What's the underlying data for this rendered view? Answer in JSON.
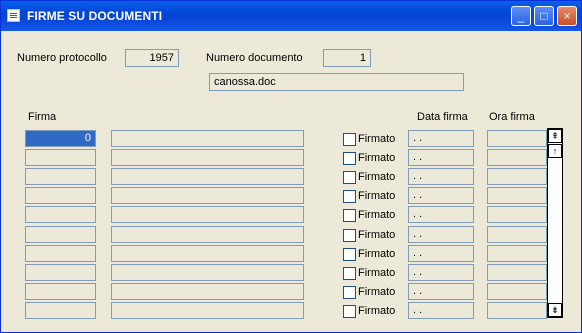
{
  "window": {
    "title": "FIRME SU DOCUMENTI",
    "controls": {
      "minimize": "_",
      "maximize": "□",
      "close": "×"
    }
  },
  "header": {
    "protocol_label": "Numero protocollo",
    "protocol_value": "1957",
    "document_label": "Numero documento",
    "document_value": "1",
    "filename": "canossa.doc"
  },
  "columns": {
    "firma": "Firma",
    "data_firma": "Data firma",
    "ora_firma": "Ora firma"
  },
  "rows": [
    {
      "firma_code": "0",
      "firma_name": "",
      "firmato_label": "Firmato",
      "date": " . .",
      "time": ""
    },
    {
      "firma_code": "",
      "firma_name": "",
      "firmato_label": "Firmato",
      "date": " . .",
      "time": ""
    },
    {
      "firma_code": "",
      "firma_name": "",
      "firmato_label": "Firmato",
      "date": " . .",
      "time": ""
    },
    {
      "firma_code": "",
      "firma_name": "",
      "firmato_label": "Firmato",
      "date": " . .",
      "time": ""
    },
    {
      "firma_code": "",
      "firma_name": "",
      "firmato_label": "Firmato",
      "date": " . .",
      "time": ""
    },
    {
      "firma_code": "",
      "firma_name": "",
      "firmato_label": "Firmato",
      "date": " . .",
      "time": ""
    },
    {
      "firma_code": "",
      "firma_name": "",
      "firmato_label": "Firmato",
      "date": " . .",
      "time": ""
    },
    {
      "firma_code": "",
      "firma_name": "",
      "firmato_label": "Firmato",
      "date": " . .",
      "time": ""
    },
    {
      "firma_code": "",
      "firma_name": "",
      "firmato_label": "Firmato",
      "date": " . .",
      "time": ""
    },
    {
      "firma_code": "",
      "firma_name": "",
      "firmato_label": "Firmato",
      "date": " . .",
      "time": ""
    }
  ],
  "scrollbar": {
    "first_icon": "scroll-first-icon",
    "up_icon": "scroll-up-icon",
    "last_icon": "scroll-last-icon"
  }
}
